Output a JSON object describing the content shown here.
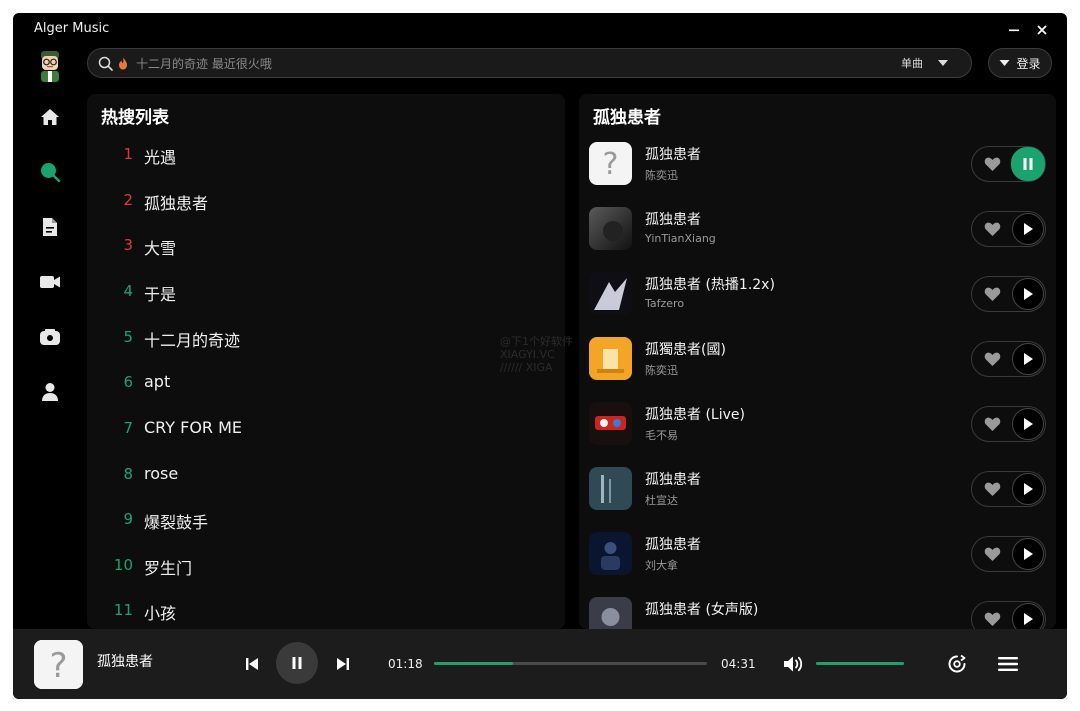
{
  "window": {
    "title": "Alger Music"
  },
  "search": {
    "placeholder": "十二月的奇迹 最近很火哦",
    "type_label": "单曲"
  },
  "login": {
    "label": "登录"
  },
  "hot": {
    "title": "热搜列表",
    "items": [
      {
        "rank": "1",
        "name": "光遇"
      },
      {
        "rank": "2",
        "name": "孤独患者"
      },
      {
        "rank": "3",
        "name": "大雪"
      },
      {
        "rank": "4",
        "name": "于是"
      },
      {
        "rank": "5",
        "name": "十二月的奇迹"
      },
      {
        "rank": "6",
        "name": "apt"
      },
      {
        "rank": "7",
        "name": "CRY FOR ME"
      },
      {
        "rank": "8",
        "name": "rose"
      },
      {
        "rank": "9",
        "name": "爆裂鼓手"
      },
      {
        "rank": "10",
        "name": "罗生门"
      },
      {
        "rank": "11",
        "name": "小孩"
      }
    ]
  },
  "results": {
    "title": "孤独患者",
    "songs": [
      {
        "title": "孤独患者",
        "artist": "陈奕迅"
      },
      {
        "title": "孤独患者",
        "artist": "YinTianXiang"
      },
      {
        "title": "孤独患者 (热播1.2x)",
        "artist": "Tafzero"
      },
      {
        "title": "孤獨患者(國)",
        "artist": "陈奕迅"
      },
      {
        "title": "孤独患者 (Live)",
        "artist": "毛不易"
      },
      {
        "title": "孤独患者",
        "artist": "杜宣达"
      },
      {
        "title": "孤独患者",
        "artist": "刘大拿"
      },
      {
        "title": "孤独患者 (女声版)",
        "artist": ""
      }
    ]
  },
  "player": {
    "title": "孤独患者",
    "current_time": "01:18",
    "total_time": "04:31",
    "progress": 0.29,
    "volume": 1.0
  },
  "watermark": {
    "line1": "@下1个好软件",
    "line2": "XIAGYI.VC",
    "line3": "////// XIGA"
  },
  "colors": {
    "accent": "#1aa36f",
    "top_rank": "#e0353a"
  }
}
